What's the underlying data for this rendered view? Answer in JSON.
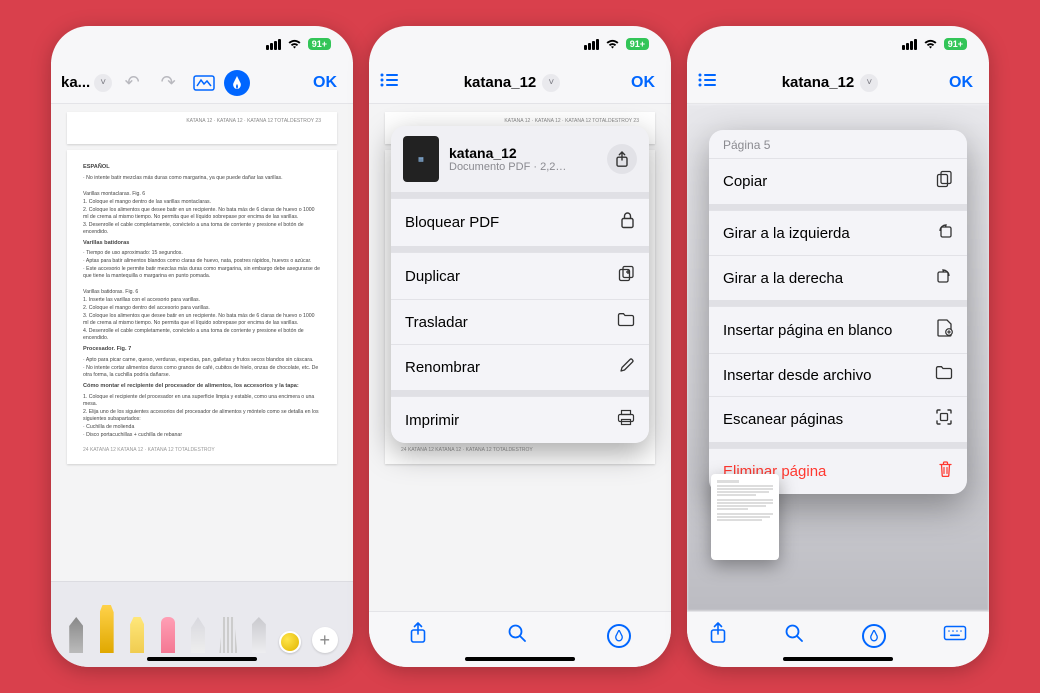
{
  "status": {
    "battery": "91+"
  },
  "phone1": {
    "title": "ka...",
    "ok": "OK",
    "doc": {
      "header_right": "KATANA 12 · KATANA 12 · KATANA 12 TOTALDESTROY     23",
      "h_espanol": "ESPAÑOL",
      "warn": "·   No intente batir mezclas más duras como margarina, ya que puede dañar las varillas.",
      "h_mont": "Varillas montaclaras. Fig. 6",
      "mont1": "1.   Coloque el mango dentro de las varillas montaclaras.",
      "mont2": "2.   Coloque los alimentos que desee batir en un recipiente. No bata más de 6 claras de huevo o 1000 ml de crema al mismo tiempo. No permita que el líquido sobrepase por encima de las varillas.",
      "mont3": "3.   Desenrolle el cable completamente, conéctelo a una toma de corriente y presione el botón de encendido.",
      "h_bat": "Varillas batidoras",
      "bat1": "·   Tiempo de uso aproximado: 15 segundos.",
      "bat2": "·   Aptas para batir alimentos blandos como claras de huevo, nata, postres rápidos, huevos o azúcar.",
      "bat3": "·   Este accesorio le permite batir mezclas más duras como margarina, sin embargo debe asegurarse de que tiene la mantequilla o margarina en punto pomada.",
      "h_bat2": "Varillas batidoras. Fig. 6",
      "bat2_1": "1.   Inserte las varillas con el accesorio para varillas.",
      "bat2_2": "2.   Coloque el mango dentro del accesorio para varillas.",
      "bat2_3": "3.   Coloque los alimentos que desee batir en un recipiente. No bata más de 6 claras de huevo o 1000 ml de crema al mismo tiempo. No permita que el líquido sobrepase por encima de las varillas.",
      "bat2_4": "4.   Desenrolle el cable completamente, conéctelo a una toma de corriente y presione el botón de encendido.",
      "h_proc": "Procesador. Fig. 7",
      "proc1": "·   Apto para picar carne, queso, verduras, especias, pan, galletas y frutos secos blandos sin cáscara.",
      "proc2": "·   No intente cortar alimentos duros como granos de café, cubitos de hielo, onzas de chocolate, etc. De otra forma, la cuchilla podría dañarse.",
      "h_como": "Cómo montar el recipiente del procesador de alimentos, los accesorios y la tapa:",
      "como1": "1.   Coloque el recipiente del procesador en una superficie limpia y estable, como una encimera o una mesa.",
      "como2": "2.   Elija uno de los siguientes accesorios del procesador de alimentos y móntelo como se detalla en los siguientes subapartados:",
      "como3": "·   Cuchilla de molienda",
      "como4": "·   Disco portacuchillas + cuchilla de rebanar",
      "footer": "24     KATANA 12 KATANA 12 · KATANA 12 TOTALDESTROY"
    }
  },
  "phone2": {
    "title": "katana_12",
    "ok": "OK",
    "pop": {
      "name": "katana_12",
      "sub": "Documento PDF · 2,2…",
      "items": [
        {
          "label": "Bloquear PDF",
          "icon": "lock-icon"
        },
        {
          "label": "Duplicar",
          "icon": "duplicate-icon"
        },
        {
          "label": "Trasladar",
          "icon": "folder-icon"
        },
        {
          "label": "Renombrar",
          "icon": "pencil-icon"
        },
        {
          "label": "Imprimir",
          "icon": "print-icon"
        }
      ]
    }
  },
  "phone3": {
    "title": "katana_12",
    "ok": "OK",
    "ctx": {
      "header": "Página 5",
      "groups": [
        [
          {
            "label": "Copiar",
            "icon": "copy-icon"
          }
        ],
        [
          {
            "label": "Girar a la izquierda",
            "icon": "rotate-left-icon"
          },
          {
            "label": "Girar a la derecha",
            "icon": "rotate-right-icon"
          }
        ],
        [
          {
            "label": "Insertar página en blanco",
            "icon": "blank-page-icon"
          },
          {
            "label": "Insertar desde archivo",
            "icon": "folder-icon"
          },
          {
            "label": "Escanear páginas",
            "icon": "scan-icon"
          }
        ],
        [
          {
            "label": "Eliminar página",
            "icon": "trash-icon",
            "danger": true
          }
        ]
      ]
    }
  }
}
